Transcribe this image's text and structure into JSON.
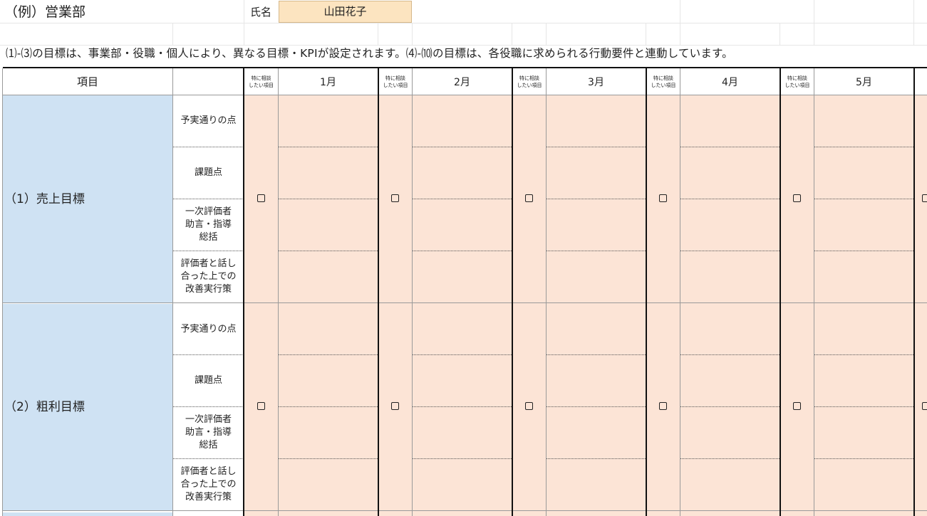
{
  "header": {
    "department": "（例）営業部",
    "name_label": "氏名",
    "name_value": "山田花子"
  },
  "notice": "⑴-⑶の目標は、事業部・役職・個人により、異なる目標・KPIが設定されます。⑷-⑽の目標は、各役職に求められる行動要件と連動しています。",
  "table": {
    "item_header": "項目",
    "consult_header_line1": "特に相談",
    "consult_header_line2": "したい項目",
    "months": [
      "1月",
      "2月",
      "3月",
      "4月",
      "5月"
    ],
    "sub_rows": {
      "r1": "予実通りの点",
      "r2": "課題点",
      "r3a": "一次評価者",
      "r3b": "助言・指導",
      "r3c": "総括",
      "r4a": "評価者と話し",
      "r4b": "合った上での",
      "r4c": "改善実行策"
    },
    "sections": [
      {
        "title": "（1）売上目標"
      },
      {
        "title": "（2）粗利目標"
      }
    ]
  },
  "colors": {
    "entry_fill": "#fce4d6",
    "item_fill": "#cfe2f3",
    "name_fill": "#fce4c0"
  }
}
